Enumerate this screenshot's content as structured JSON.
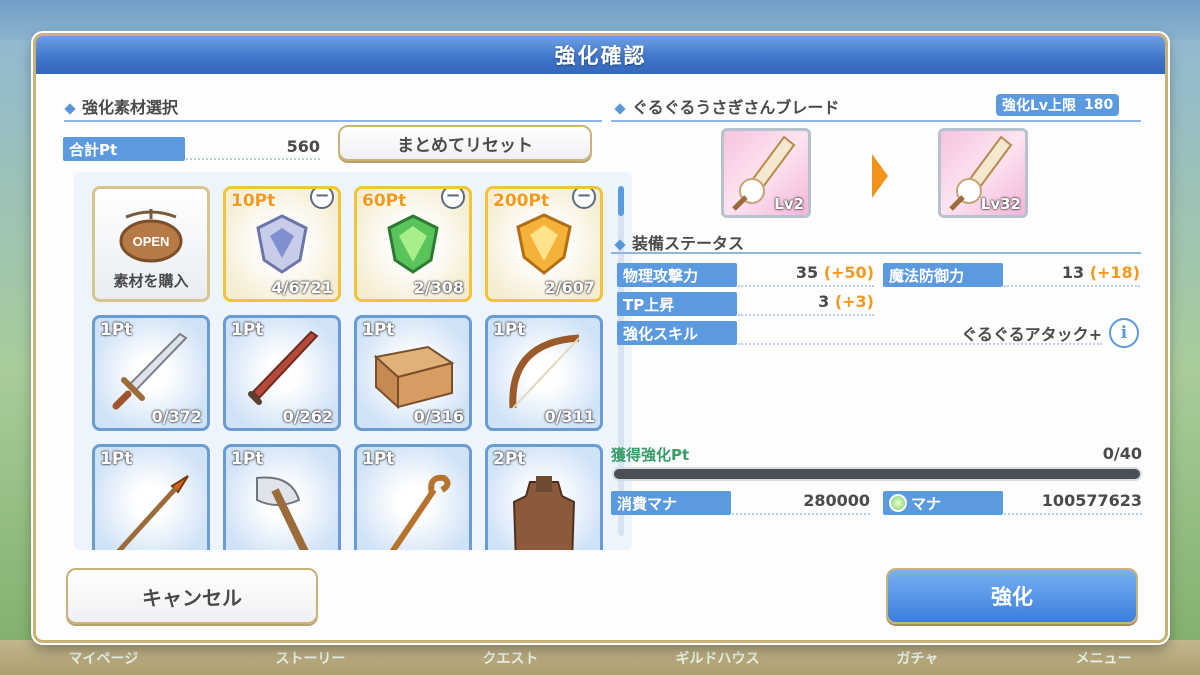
{
  "dialog": {
    "title": "強化確認"
  },
  "background_nav": [
    "マイページ",
    "ストーリー",
    "クエスト",
    "ギルドハウス",
    "ガチャ",
    "メニュー"
  ],
  "materials": {
    "heading": "強化素材選択",
    "total_label": "合計Pt",
    "total_value": "560",
    "reset_button": "まとめてリセット",
    "shop": {
      "sign": "OPEN",
      "label": "素材を購入"
    },
    "items": [
      {
        "pt": "10Pt",
        "count": "4/6721",
        "kind": "gold",
        "icon": "blue-crystal-shield-icon"
      },
      {
        "pt": "60Pt",
        "count": "2/308",
        "kind": "gold",
        "icon": "green-crystal-shield-icon"
      },
      {
        "pt": "200Pt",
        "count": "2/607",
        "kind": "gold",
        "icon": "gold-crystal-shield-icon"
      },
      {
        "pt": "1Pt",
        "count": "0/372",
        "kind": "blue",
        "icon": "sword-icon"
      },
      {
        "pt": "1Pt",
        "count": "0/262",
        "kind": "blue",
        "icon": "dagger-icon"
      },
      {
        "pt": "1Pt",
        "count": "0/316",
        "kind": "blue",
        "icon": "wooden-box-icon"
      },
      {
        "pt": "1Pt",
        "count": "0/311",
        "kind": "blue",
        "icon": "bow-icon"
      },
      {
        "pt": "1Pt",
        "count": "",
        "kind": "blue",
        "icon": "spear-icon"
      },
      {
        "pt": "1Pt",
        "count": "",
        "kind": "blue",
        "icon": "axe-icon"
      },
      {
        "pt": "1Pt",
        "count": "",
        "kind": "blue",
        "icon": "staff-icon"
      },
      {
        "pt": "2Pt",
        "count": "",
        "kind": "blue",
        "icon": "armor-icon"
      }
    ]
  },
  "equipment": {
    "name": "ぐるぐるうさぎさんブレード",
    "limit_label": "強化Lv上限",
    "limit_value": "180",
    "lv_before": "Lv2",
    "lv_after": "Lv32",
    "status_heading": "装備ステータス",
    "stats": [
      {
        "label": "物理攻撃力",
        "value": "35",
        "bonus": "(+50)"
      },
      {
        "label": "魔法防御力",
        "value": "13",
        "bonus": "(+18)"
      },
      {
        "label": "TP上昇",
        "value": "3",
        "bonus": "(+3)"
      }
    ],
    "skill_label": "強化スキル",
    "skill_value": "ぐるぐるアタック+"
  },
  "progress": {
    "label": "獲得強化Pt",
    "value": "0/40",
    "fraction": 0
  },
  "cost": {
    "mana_cost_label": "消費マナ",
    "mana_cost_value": "280000",
    "mana_label": "マナ",
    "mana_value": "100577623"
  },
  "buttons": {
    "cancel": "キャンセル",
    "enhance": "強化"
  },
  "colors": {
    "accent_blue": "#5c9ae0",
    "gold_border": "#f0c53a",
    "bonus_orange": "#f29a1c",
    "title_blue": "#3e74c9"
  }
}
